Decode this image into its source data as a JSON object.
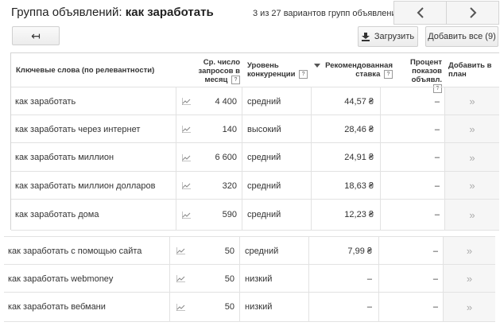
{
  "header": {
    "title_prefix": "Группа объявлений: ",
    "title_group": "как заработать",
    "pager_text": "3 из 27 вариантов групп объявлений"
  },
  "toolbar": {
    "back_symbol": "↤",
    "upload_label": "Загрузить",
    "add_all_label": "Добавить все (9)"
  },
  "table": {
    "headers": {
      "keyword": "Ключевые слова (по релевантности)",
      "volume": "Ср. число запросов в месяц",
      "competition": "Уровень конкуренции",
      "bid": "Рекомендованная ставка",
      "share": "Процент показов объявл.",
      "add": "Добавить в план",
      "help": "?"
    },
    "rows": [
      {
        "keyword": "как заработать",
        "volume": "4 400",
        "competition": "средний",
        "bid": "44,57 ₴",
        "share": "–",
        "add": "»"
      },
      {
        "keyword": "как заработать через интернет",
        "volume": "140",
        "competition": "высокий",
        "bid": "28,46 ₴",
        "share": "–",
        "add": "»"
      },
      {
        "keyword": "как заработать миллион",
        "volume": "6 600",
        "competition": "средний",
        "bid": "24,91 ₴",
        "share": "–",
        "add": "»"
      },
      {
        "keyword": "как заработать миллион долларов",
        "volume": "320",
        "competition": "средний",
        "bid": "18,63 ₴",
        "share": "–",
        "add": "»"
      },
      {
        "keyword": "как заработать дома",
        "volume": "590",
        "competition": "средний",
        "bid": "12,23 ₴",
        "share": "–",
        "add": "»"
      },
      {
        "keyword": "как заработать с помощью сайта",
        "volume": "50",
        "competition": "средний",
        "bid": "7,99 ₴",
        "share": "–",
        "add": "»"
      },
      {
        "keyword": "как заработать webmoney",
        "volume": "50",
        "competition": "низкий",
        "bid": "–",
        "share": "–",
        "add": "»"
      },
      {
        "keyword": "как заработать вебмани",
        "volume": "50",
        "competition": "низкий",
        "bid": "–",
        "share": "–",
        "add": "»"
      }
    ]
  }
}
